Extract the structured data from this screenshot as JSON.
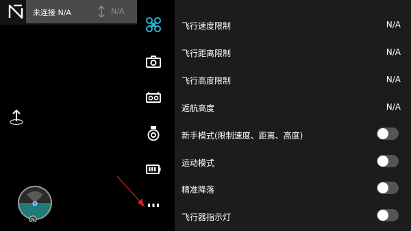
{
  "status": {
    "connection_text": "未连接 N/A",
    "altitude_value": "N/A"
  },
  "colors": {
    "accent": "#29b6d6",
    "panel_bg": "#1c1c1c",
    "status_bar_bg": "#4a4a4a",
    "toggle_off": "#555555",
    "annotation_arrow": "#d9231e"
  },
  "sidebar": {
    "icons": [
      "drone-icon",
      "camera-icon",
      "remote-controller-icon",
      "gimbal-icon",
      "battery-icon",
      "more-icon"
    ],
    "active": "drone-icon"
  },
  "compass": {
    "north_label": "N"
  },
  "settings": {
    "rows": [
      {
        "label": "飞行速度限制",
        "value": "N/A"
      },
      {
        "label": "飞行距离限制",
        "value": "N/A"
      },
      {
        "label": "飞行高度限制",
        "value": "N/A"
      },
      {
        "label": "返航高度",
        "value": "N/A"
      },
      {
        "label": "新手模式(限制速度、距离、高度)",
        "toggle": false
      },
      {
        "label": "运动模式",
        "toggle": false
      },
      {
        "label": "精准降落",
        "toggle": false
      },
      {
        "label": "飞行器指示灯",
        "toggle": false
      }
    ]
  }
}
